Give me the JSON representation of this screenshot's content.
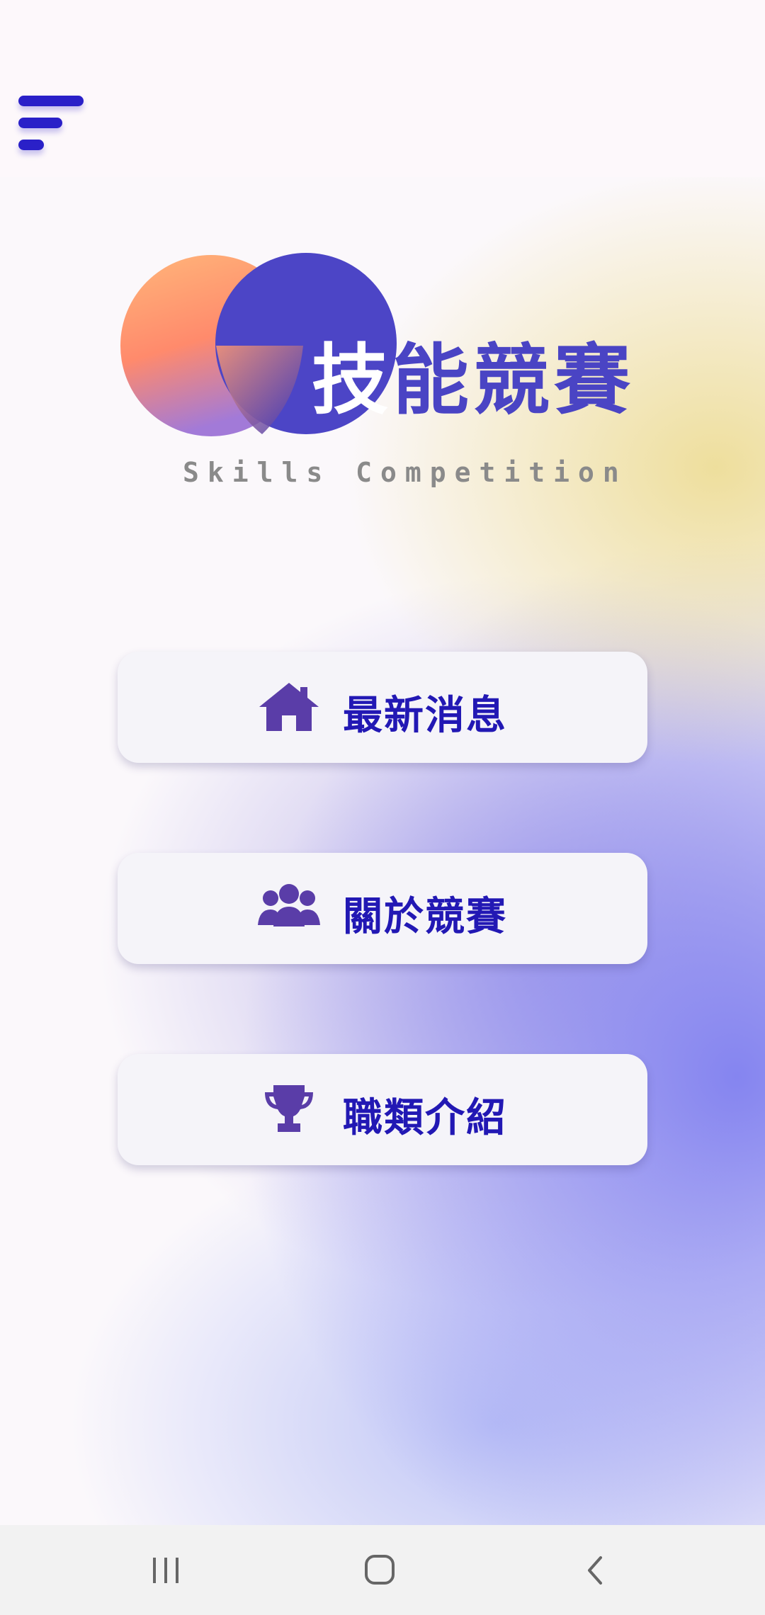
{
  "app": {
    "logo": {
      "title": "技能競賽",
      "subtitle": "Skills Competition"
    },
    "menu": [
      {
        "label": "最新消息",
        "icon": "home-icon"
      },
      {
        "label": "關於競賽",
        "icon": "group-icon"
      },
      {
        "label": "職類介紹",
        "icon": "trophy-icon"
      }
    ]
  },
  "colors": {
    "accent": "#2218b4",
    "logo_purple": "#4a44c4",
    "icon_purple": "#5a3da8",
    "card_bg": "#f5f4f9"
  },
  "system_nav": {
    "recents": "recents-icon",
    "home": "home-circle-icon",
    "back": "back-icon"
  }
}
